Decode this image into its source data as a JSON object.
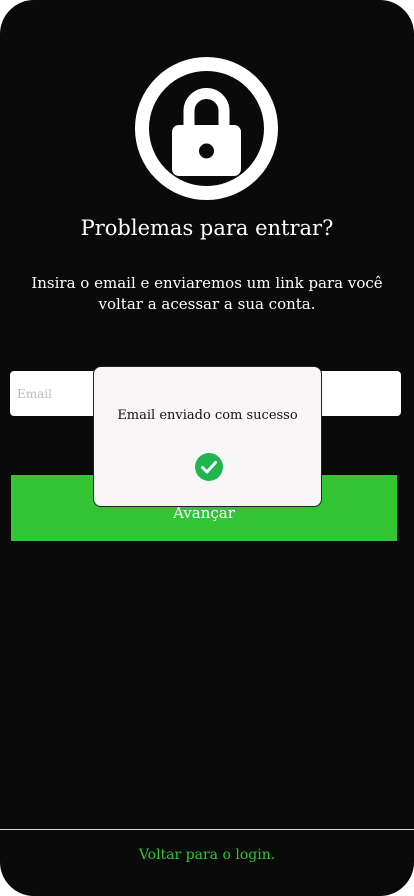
{
  "header": {
    "title": "Problemas para entrar?",
    "subtitle": "Insira o email e enviaremos um link para você voltar a acessar a sua conta."
  },
  "form": {
    "email_placeholder": "Email",
    "email_value": "",
    "submit_label": "Avançar"
  },
  "footer": {
    "back_link_label": "Voltar para o login."
  },
  "toast": {
    "message": "Email enviado com sucesso",
    "icon": "check-circle-icon"
  },
  "colors": {
    "background": "#0a0a0a",
    "accent": "#33c433",
    "toast_background": "#f7f5f5",
    "success": "#1fb551"
  },
  "icons": {
    "lock": "lock-icon"
  }
}
